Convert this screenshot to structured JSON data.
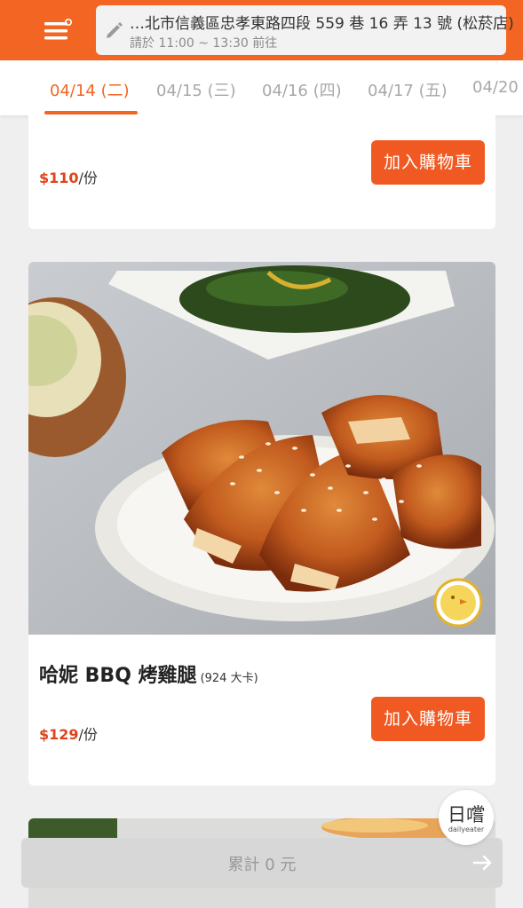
{
  "header": {
    "address": "…北市信義區忠孝東路四段 559 巷 16 弄 13 號 (松菸店)",
    "pickup_time": "請於 11:00 ~ 13:30 前往"
  },
  "date_tabs": [
    {
      "label": "04/14 (二)",
      "active": true
    },
    {
      "label": "04/15 (三)",
      "active": false
    },
    {
      "label": "04/16 (四)",
      "active": false
    },
    {
      "label": "04/17 (五)",
      "active": false
    },
    {
      "label": "04/20",
      "active": false
    }
  ],
  "items": [
    {
      "price": "$110",
      "unit": "/份",
      "cart_label": "加入購物車"
    },
    {
      "title": "哈妮 BBQ 烤雞腿",
      "calories": "(924 大卡)",
      "price": "$129",
      "unit": "/份",
      "cart_label": "加入購物車"
    }
  ],
  "footer": {
    "total_label": "累計 0 元"
  },
  "brand": {
    "logo_text": "日嚐",
    "logo_sub": "dailyeater"
  },
  "colors": {
    "accent": "#f26522",
    "price": "#e0441a",
    "background": "#efefef"
  }
}
